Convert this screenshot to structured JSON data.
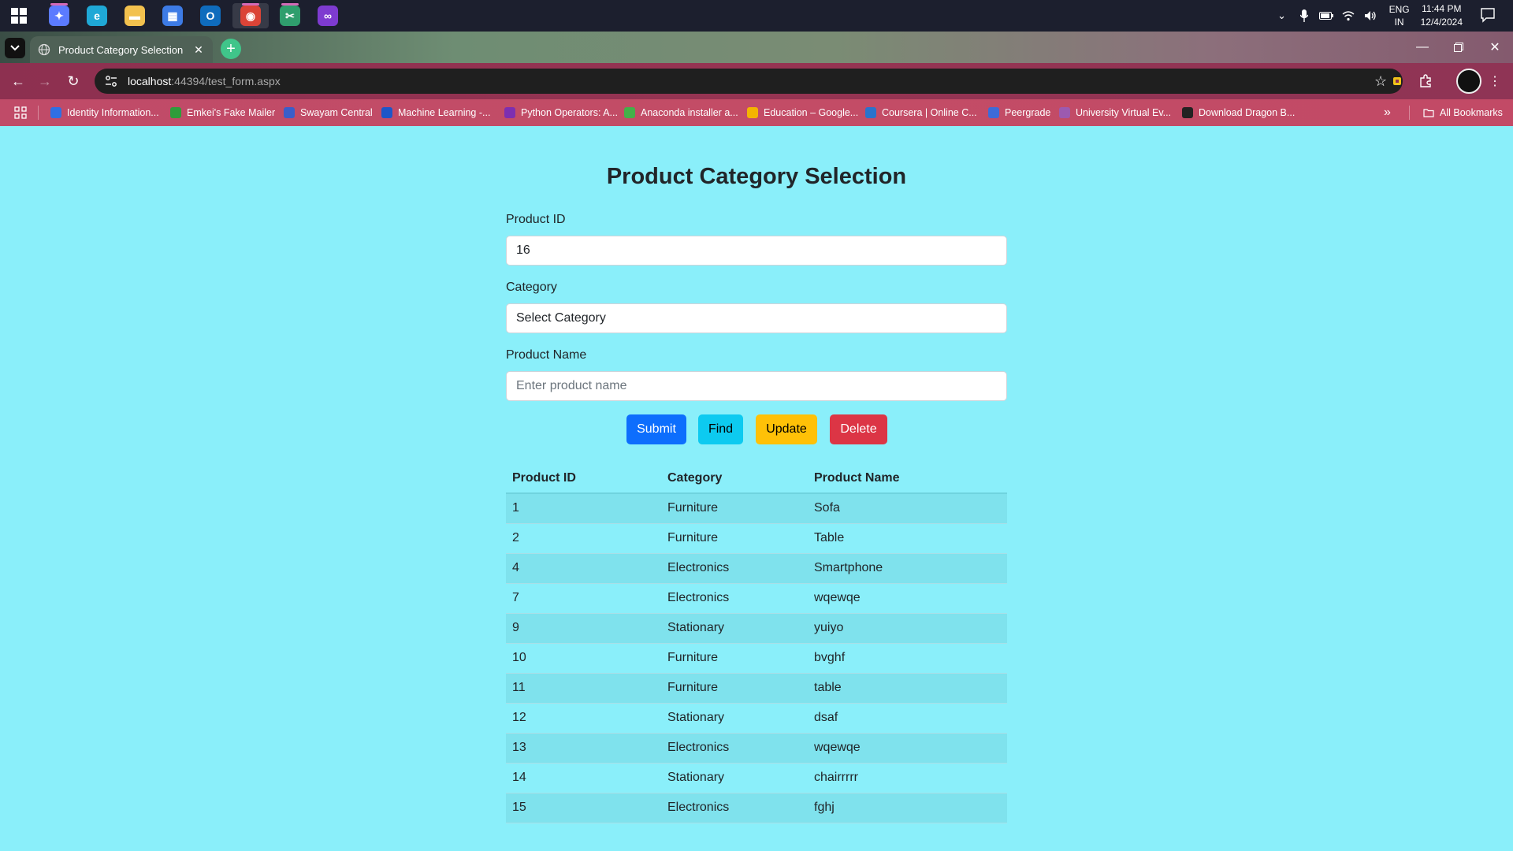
{
  "taskbar": {
    "apps": [
      {
        "icon": "copilot-icon",
        "color": "#5b7bff"
      },
      {
        "icon": "edge-icon",
        "color": "#1fa8d6"
      },
      {
        "icon": "file-explorer-icon",
        "color": "#f2c14e"
      },
      {
        "icon": "microsoft-store-icon",
        "color": "#3d7be5"
      },
      {
        "icon": "outlook-icon",
        "color": "#0f6cbd"
      },
      {
        "icon": "chrome-icon",
        "color": "#db4437"
      },
      {
        "icon": "snipping-tool-icon",
        "color": "#2f9e6d"
      },
      {
        "icon": "visual-studio-icon",
        "color": "#7e3bd0"
      }
    ],
    "lang_line1": "ENG",
    "lang_line2": "IN",
    "time": "11:44 PM",
    "date": "12/4/2024"
  },
  "browser": {
    "tab_title": "Product Category Selection",
    "url_host": "localhost",
    "url_path": ":44394/test_form.aspx",
    "bookmarks": [
      {
        "label": "Identity Information...",
        "color": "#2f6fe4"
      },
      {
        "label": "Emkei's Fake Mailer",
        "color": "#2e9d3a"
      },
      {
        "label": "Swayam Central",
        "color": "#3b5ec9"
      },
      {
        "label": "Machine Learning -...",
        "color": "#1e56c8"
      },
      {
        "label": "Python Operators: A...",
        "color": "#7d2fb0"
      },
      {
        "label": "Anaconda installer a...",
        "color": "#43b049"
      },
      {
        "label": "Education – Google...",
        "color": "#f4b400"
      },
      {
        "label": "Coursera | Online C...",
        "color": "#2a73cc"
      },
      {
        "label": "Peergrade",
        "color": "#3d6bd8"
      },
      {
        "label": "University Virtual Ev...",
        "color": "#9c5ab0"
      },
      {
        "label": "Download Dragon B...",
        "color": "#222222"
      }
    ],
    "all_bookmarks": "All Bookmarks"
  },
  "form": {
    "heading": "Product Category Selection",
    "product_id_label": "Product ID",
    "product_id_value": "16",
    "category_label": "Category",
    "category_value": "Select Category",
    "product_name_label": "Product Name",
    "product_name_placeholder": "Enter product name",
    "buttons": {
      "submit": "Submit",
      "find": "Find",
      "update": "Update",
      "delete": "Delete"
    }
  },
  "table": {
    "headers": [
      "Product ID",
      "Category",
      "Product Name"
    ],
    "rows": [
      [
        "1",
        "Furniture",
        "Sofa"
      ],
      [
        "2",
        "Furniture",
        "Table"
      ],
      [
        "4",
        "Electronics",
        "Smartphone"
      ],
      [
        "7",
        "Electronics",
        "wqewqe"
      ],
      [
        "9",
        "Stationary",
        "yuiyo"
      ],
      [
        "10",
        "Furniture",
        "bvghf"
      ],
      [
        "11",
        "Furniture",
        "table"
      ],
      [
        "12",
        "Stationary",
        "dsaf"
      ],
      [
        "13",
        "Electronics",
        "wqewqe"
      ],
      [
        "14",
        "Stationary",
        "chairrrrr"
      ],
      [
        "15",
        "Electronics",
        "fghj"
      ]
    ]
  }
}
